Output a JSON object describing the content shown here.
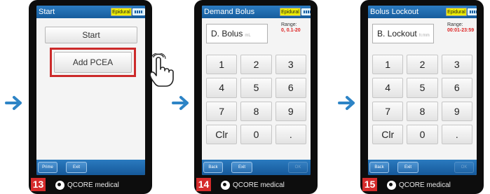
{
  "colors": {
    "title_bar": "#1f6db1",
    "arrow": "#2d84c6",
    "step_badge": "#d52b2b",
    "highlight": "#cc2a2a",
    "range_value": "#dd2222",
    "mode_badge": "#eded00"
  },
  "icons": {
    "arrow": "right-arrow-icon",
    "battery": "battery-icon",
    "hand": "hand-pointer-icon",
    "logo": "qcore-logo-icon"
  },
  "brand": "QCORE medical",
  "screens": [
    {
      "step": "13",
      "title": "Start",
      "mode": "Epidural",
      "start_label": "Start",
      "add_pcea_label": "Add PCEA",
      "bottom": {
        "left": "Prime",
        "mid": "Exit"
      }
    },
    {
      "step": "14",
      "title": "Demand Bolus",
      "mode": "Epidural",
      "field_label": "D. Bolus",
      "field_unit": "mL",
      "range_label": "Range:",
      "range_value": "0, 0.1-20",
      "keys": [
        "1",
        "2",
        "3",
        "4",
        "5",
        "6",
        "7",
        "8",
        "9",
        "Clr",
        "0",
        "."
      ],
      "bottom": {
        "left": "Back",
        "mid": "Exit",
        "right": "OK"
      }
    },
    {
      "step": "15",
      "title": "Bolus Lockout",
      "mode": "Epidural",
      "field_label": "B. Lockout",
      "field_unit": "h:mm",
      "range_label": "Range:",
      "range_value": "00:01-23:59",
      "keys": [
        "1",
        "2",
        "3",
        "4",
        "5",
        "6",
        "7",
        "8",
        "9",
        "Clr",
        "0",
        "."
      ],
      "bottom": {
        "left": "Back",
        "mid": "Exit",
        "right": "OK"
      }
    }
  ]
}
